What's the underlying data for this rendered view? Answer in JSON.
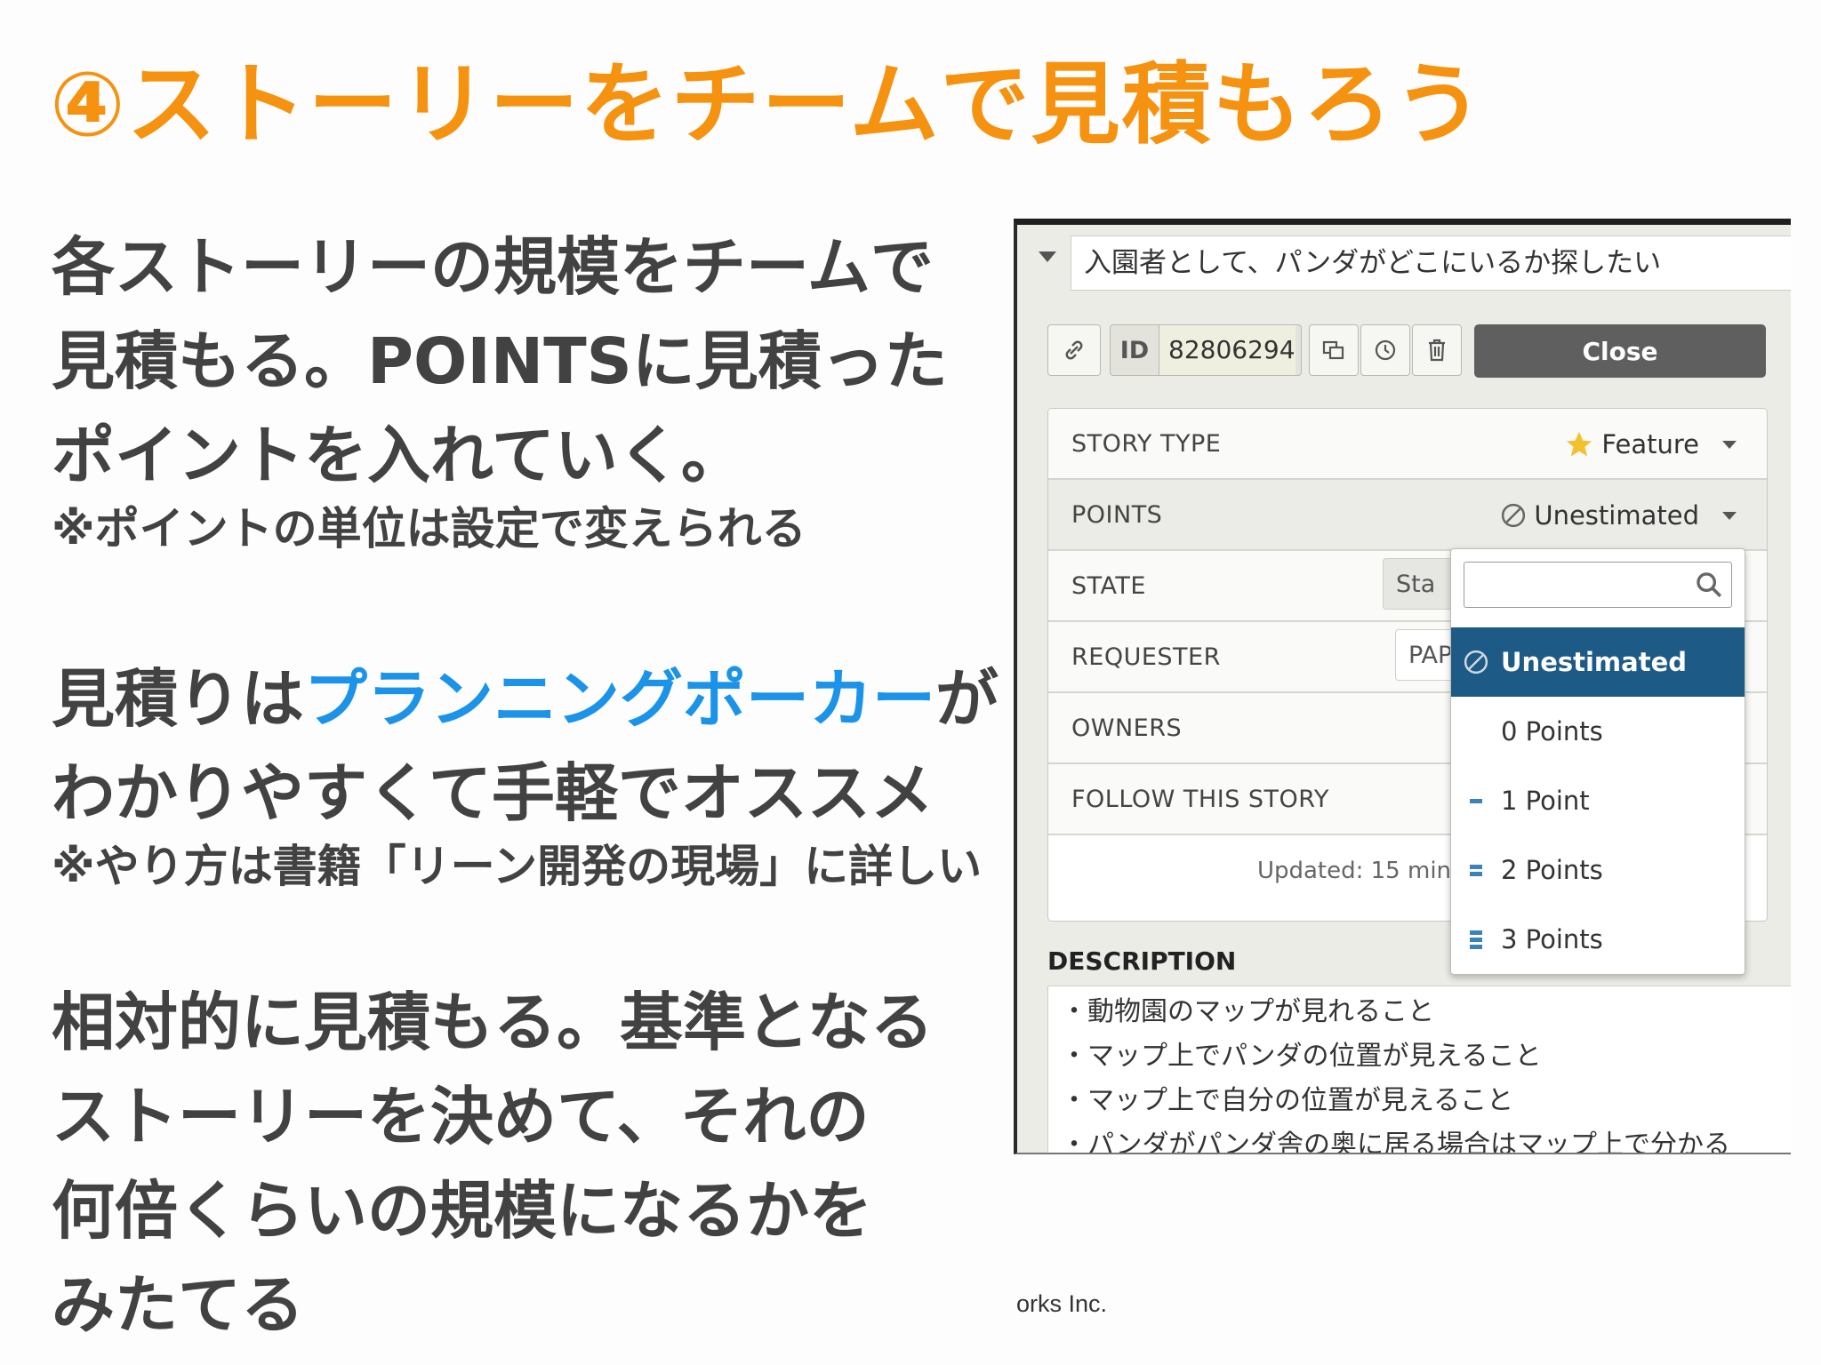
{
  "slide": {
    "title": "④ストーリーをチームで見積もろう",
    "para1": [
      "各ストーリーの規模をチームで",
      "見積もる。POINTSに見積った",
      "ポイントを入れていく。"
    ],
    "note1": "※ポイントの単位は設定で変えられる",
    "para2_line1_pre": "見積りは",
    "para2_line1_highlight": "プランニングポーカー",
    "para2_line1_post": "が",
    "para2_line2": "わかりやすくて手軽でオススメ",
    "note2": "※やり方は書籍「リーン開発の現場」に詳しい",
    "para3": [
      "相対的に見積もる。基準となる",
      "ストーリーを決めて、それの",
      "何倍くらいの規模になるかを",
      "みたてる"
    ],
    "footer": "orks Inc.",
    "title_color": "#f5920f",
    "highlight_color": "#1a93e8"
  },
  "story": {
    "name": "入園者として、パンダがどこにいるか探したい",
    "id_label": "ID",
    "id_value": "82806294",
    "close_label": "Close",
    "rows": {
      "story_type": {
        "label": "STORY TYPE",
        "value": "Feature",
        "icon": "star-icon"
      },
      "points": {
        "label": "POINTS",
        "value": "Unestimated",
        "icon": "unestimated-icon"
      },
      "state": {
        "label": "STATE",
        "value": "Sta"
      },
      "requester": {
        "label": "REQUESTER",
        "value": "PAP"
      },
      "owners": {
        "label": "OWNERS"
      },
      "follow": {
        "label": "FOLLOW THIS STORY"
      }
    },
    "updated": "Updated: 15 min",
    "description_title": "DESCRIPTION",
    "description_lines": [
      "・動物園のマップが見れること",
      "・マップ上でパンダの位置が見えること",
      "・マップ上で自分の位置が見えること",
      "・パンダがパンダ舎の奥に居る場合はマップ上で分かる"
    ]
  },
  "points_dropdown": {
    "search_value": "",
    "options": [
      {
        "label": "Unestimated",
        "selected": true
      },
      {
        "label": "0 Points",
        "bars": 0
      },
      {
        "label": "1 Point",
        "bars": 1
      },
      {
        "label": "2 Points",
        "bars": 2
      },
      {
        "label": "3 Points",
        "bars": 3
      }
    ]
  }
}
